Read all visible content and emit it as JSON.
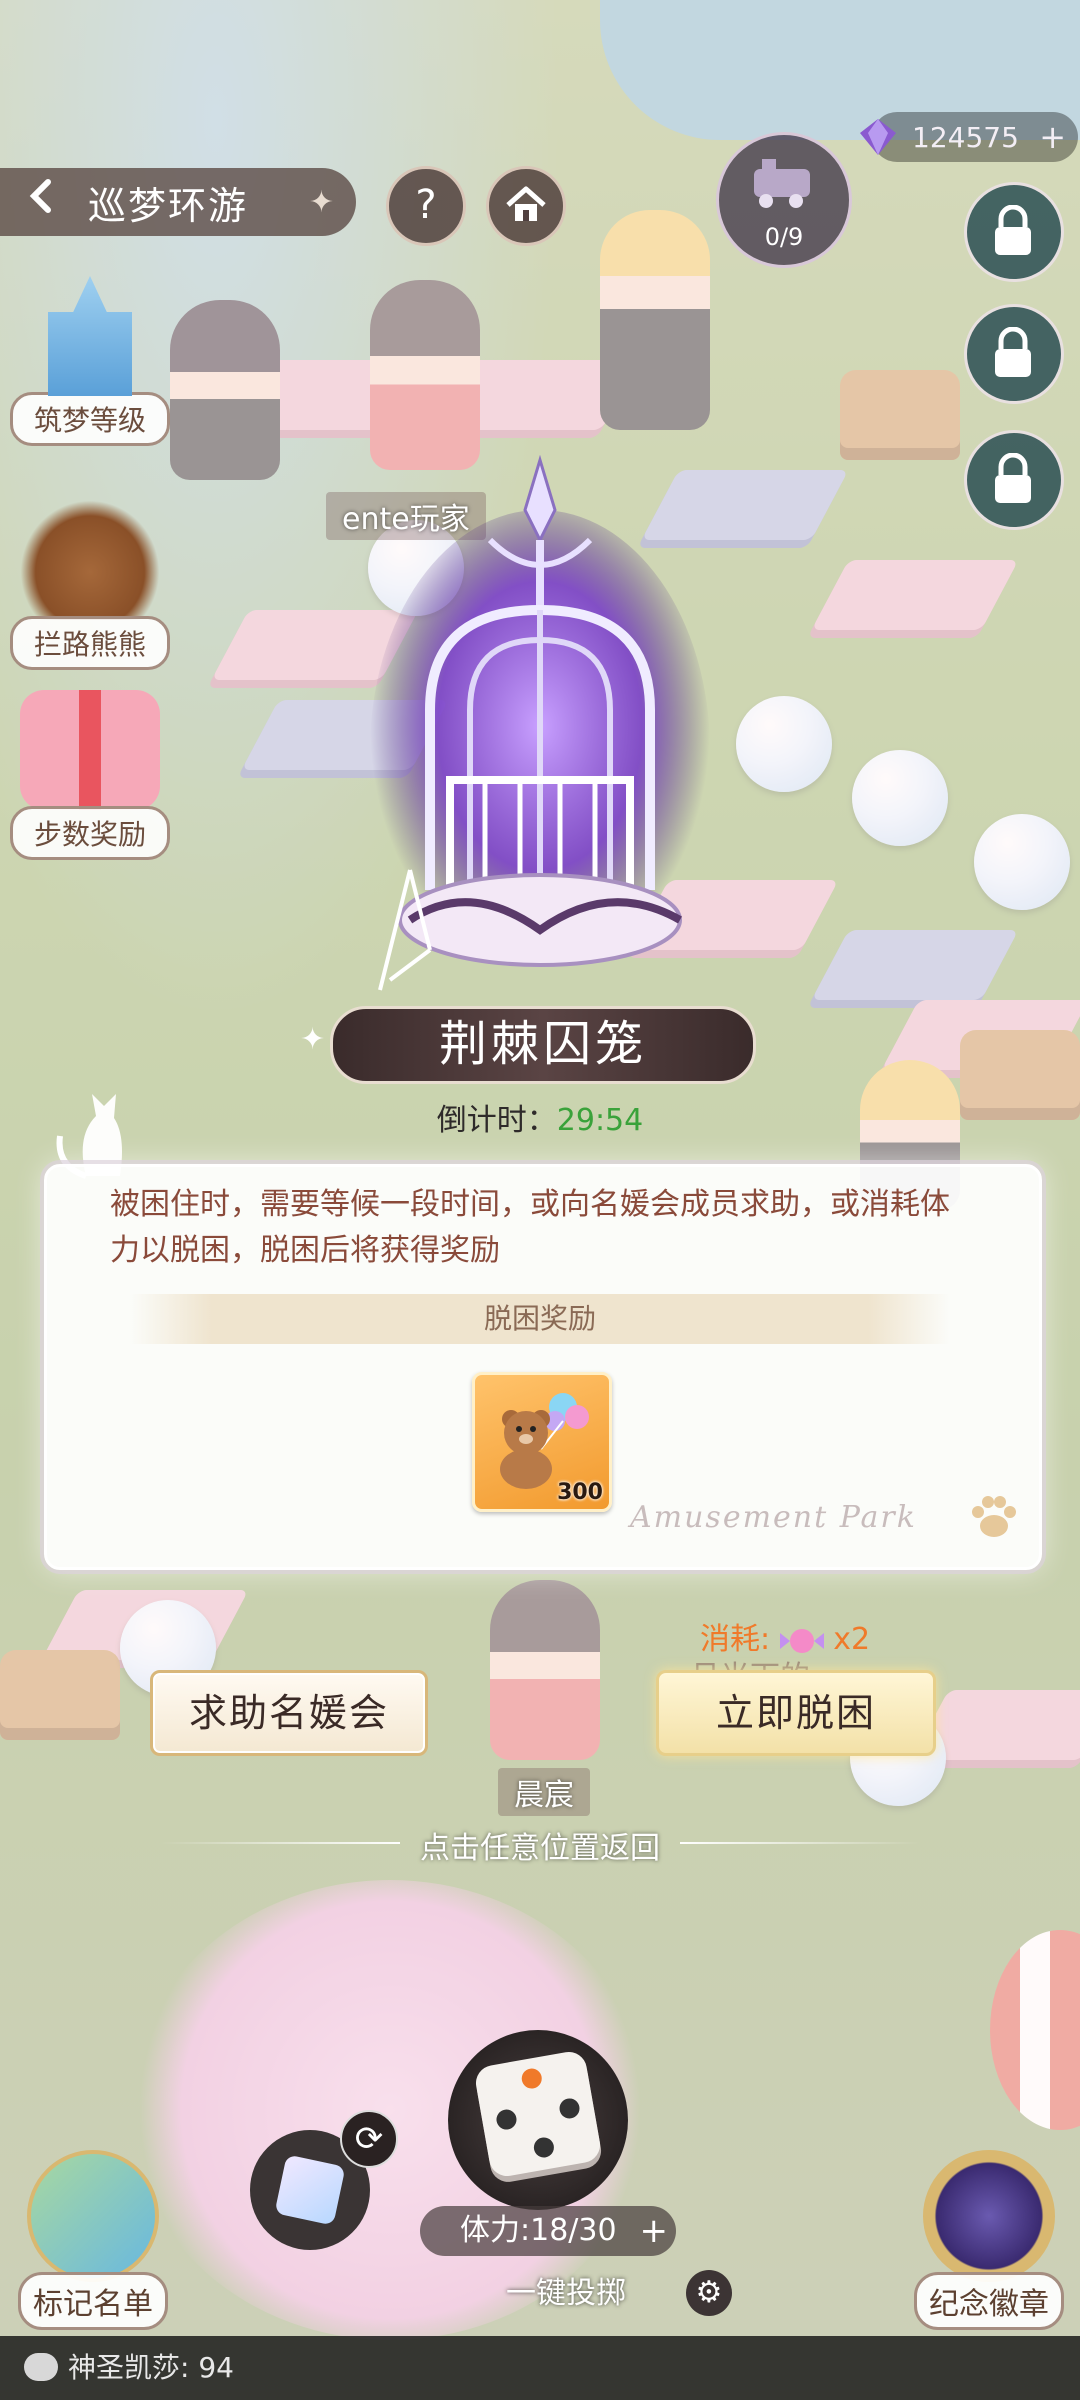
{
  "header": {
    "title": "巡梦环游",
    "back_icon": "back-arrow-icon",
    "help_label": "?",
    "home_icon": "home-icon"
  },
  "currency": {
    "gems": "124575",
    "plus": "+"
  },
  "progress": {
    "text": "0/9"
  },
  "side_menu": [
    {
      "label": "筑梦等级",
      "icon": "castle-icon"
    },
    {
      "label": "拦路熊熊",
      "icon": "bear-icon"
    },
    {
      "label": "步数奖励",
      "icon": "gift-icon"
    }
  ],
  "scene_labels": {
    "player_top": "ente玩家",
    "player_bottom": "晨宸",
    "hidden_text": "月光下的"
  },
  "popup": {
    "name": "荆棘囚笼",
    "countdown_label": "倒计时：",
    "countdown_value": "29:54",
    "description": "被困住时，需要等候一段时间，或向名媛会成员求助，或消耗体力以脱困，脱困后将获得奖励",
    "reward_title": "脱困奖励",
    "reward_qty": "300",
    "reward_icon": "teddy-bear-icon",
    "watermark": "Amusement Park",
    "cost_label": "消耗:",
    "cost_qty": "x2",
    "cost_icon": "candy-icon",
    "help_button": "求助名媛会",
    "escape_button": "立即脱困",
    "tap_return": "点击任意位置返回"
  },
  "bottom": {
    "stamina": "体力:18/30",
    "stamina_plus": "+",
    "one_key": "一键投掷",
    "mark_list": "标记名单",
    "badge": "纪念徽章"
  },
  "chat": {
    "text": "神圣凯莎: 94"
  }
}
